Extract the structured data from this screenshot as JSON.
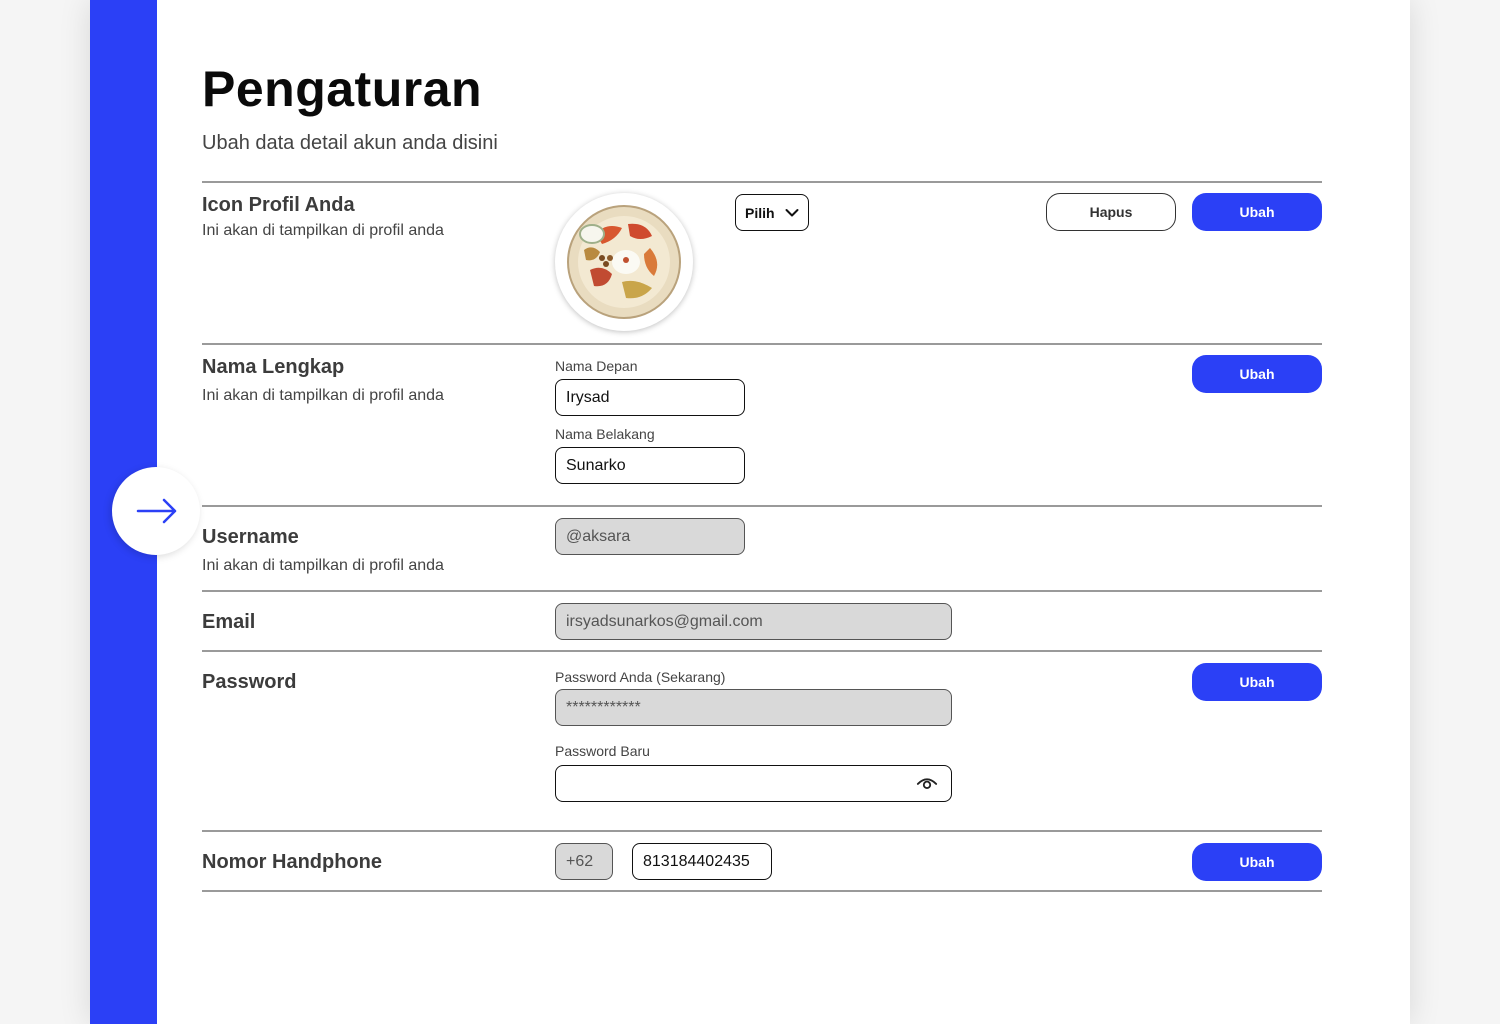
{
  "page": {
    "title": "Pengaturan",
    "subtitle": "Ubah data detail akun anda disini"
  },
  "sidebar": {
    "toggle_icon": "arrow-right-icon",
    "color": "#2b40f6"
  },
  "profile_icon": {
    "label": "Icon Profil Anda",
    "description": "Ini akan di tampilkan di profil anda",
    "select_label": "Pilih",
    "delete_label": "Hapus",
    "change_label": "Ubah"
  },
  "full_name": {
    "label": "Nama Lengkap",
    "description": "Ini akan di tampilkan di profil anda",
    "first_name_label": "Nama Depan",
    "first_name_value": "Irysad",
    "last_name_label": "Nama Belakang",
    "last_name_value": "Sunarko",
    "change_label": "Ubah"
  },
  "username": {
    "label": "Username",
    "description": "Ini akan di tampilkan di profil anda",
    "value": "@aksara"
  },
  "email": {
    "label": "Email",
    "value": "irsyadsunarkos@gmail.com"
  },
  "password": {
    "label": "Password",
    "current_label": "Password Anda (Sekarang)",
    "current_value": "************",
    "new_label": "Password Baru",
    "new_value": "",
    "change_label": "Ubah"
  },
  "phone": {
    "label": "Nomor Handphone",
    "country_code": "+62",
    "number": "813184402435",
    "change_label": "Ubah"
  },
  "colors": {
    "accent": "#2b40f6",
    "disabled_bg": "#d9d9d9"
  }
}
